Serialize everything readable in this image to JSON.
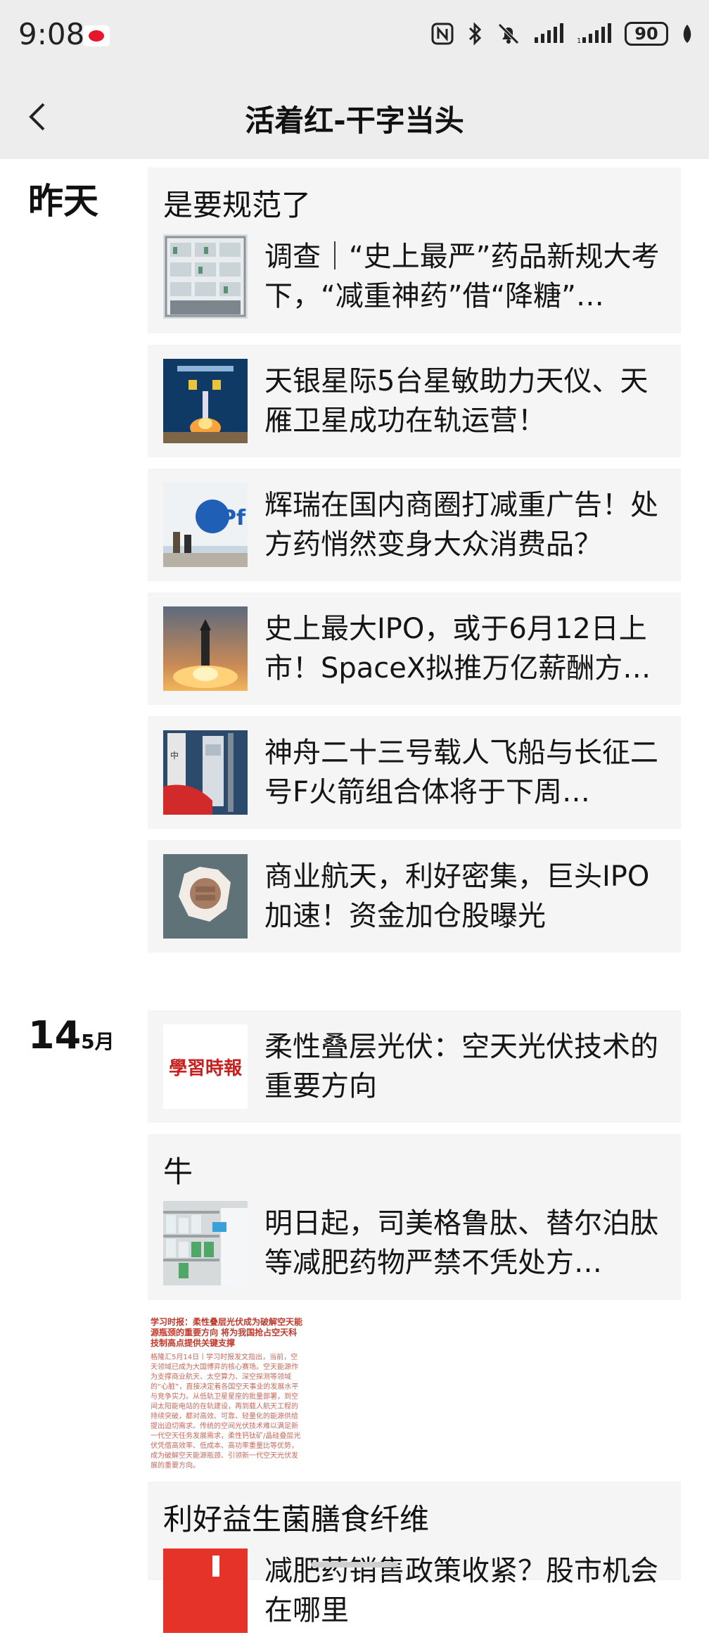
{
  "status_bar": {
    "time": "9:08",
    "battery": "90",
    "icons": [
      "nfc-icon",
      "bluetooth-icon",
      "mute-bell-icon",
      "signal-icon",
      "signal-icon",
      "battery-icon",
      "leaf-icon"
    ]
  },
  "header": {
    "title": "活着红-干字当头",
    "back_icon": "chevron-left-icon"
  },
  "sections": {
    "yesterday": {
      "label": "昨天",
      "caption": "是要规范了",
      "items": [
        {
          "title": "调查｜“史上最严”药品新规大考下，“减重神药”借“降糖”…",
          "thumb": "pharmacy-shelves"
        },
        {
          "title": "天银星际5台星敏助力天仪、天雁卫星成功在轨运营！",
          "thumb": "rocket-launch-poster"
        },
        {
          "title": "辉瑞在国内商圈打减重广告！处方药悄然变身大众消费品？",
          "thumb": "pfizer-billboard"
        },
        {
          "title": "史上最大IPO，或于6月12日上市！SpaceX拟推万亿薪酬方…",
          "thumb": "spacex-rocket"
        },
        {
          "title": "神舟二十三号载人飞船与长征二号F火箭组合体将于下周…",
          "thumb": "launch-tower-flag"
        },
        {
          "title": "商业航天，利好密集，巨头IPO加速！资金加仓股曝光",
          "thumb": "fist-through-wall"
        }
      ]
    },
    "may14": {
      "day": "14",
      "month": "5月",
      "card1": {
        "title": "柔性叠层光伏：空天光伏技术的重要方向",
        "thumb_text": "學習時報"
      },
      "card2": {
        "caption": "牛",
        "title": "明日起，司美格鲁肽、替尔泊肽等减肥药物严禁不凭处方…",
        "thumb": "pharmacy-cabinet"
      },
      "clip": {
        "headline": "学习时报：柔性叠层光伏成为破解空天能源瓶颈的重要方向 将为我国抢占空天科技制高点提供关键支撑",
        "body": "格隆汇5月14日丨学习时报发文指出，当前，空天领域已成为大国博弈的核心赛场。空天能源作为支撑商业航天、太空算力、深空探测等领域的“心脏”，直接决定着各国空天事业的发展水平与竞争实力。从低轨卫星星座的批量部署，到空间太阳能电站的在轨建设，再到载人航天工程的持续突破，都对高效、可靠、轻量化的能源供给提出迫切需求。传统的空间光伏技术难以满足新一代空天任务发展需求，柔性钙钛矿/晶硅叠层光伏凭借高效率、低成本、高功率重量比等优势，成为破解空天能源瓶颈、引领新一代空天光伏发展的重要方向。"
      },
      "card3": {
        "caption": "利好益生菌膳食纤维",
        "title": "减肥药销售政策收紧？股市机会在哪里"
      }
    }
  }
}
